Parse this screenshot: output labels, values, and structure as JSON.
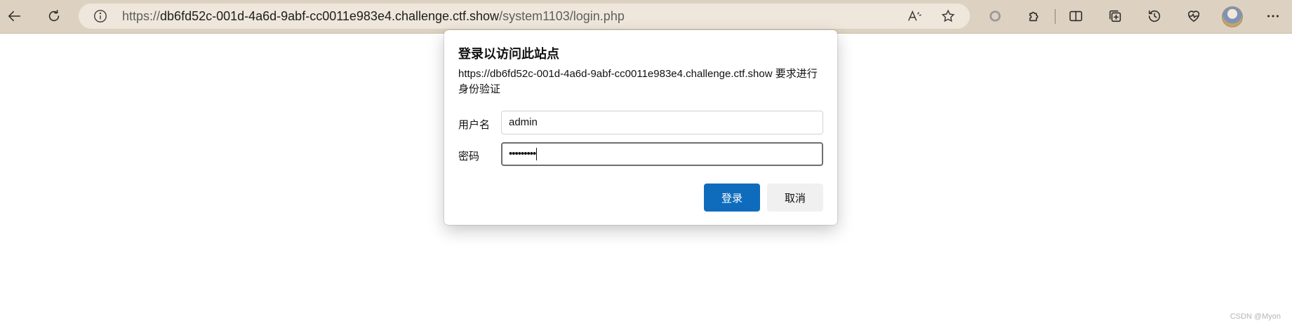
{
  "browser": {
    "url_scheme": "https://",
    "url_host": "db6fd52c-001d-4a6d-9abf-cc0011e983e4.challenge.ctf.show",
    "url_path": "/system1103/login.php",
    "icons": {
      "back": "back-arrow-icon",
      "reload": "reload-icon",
      "site_info": "info-icon",
      "read_aloud": "read-aloud-icon",
      "favorite": "star-icon",
      "extension_circle": "extension-circle-icon",
      "extensions": "puzzle-icon",
      "split_screen": "split-screen-icon",
      "collections": "collections-icon",
      "history": "history-icon",
      "performance": "heartbeat-icon",
      "profile": "avatar",
      "menu": "more-icon"
    }
  },
  "dialog": {
    "title": "登录以访问此站点",
    "message": "https://db6fd52c-001d-4a6d-9abf-cc0011e983e4.challenge.ctf.show 要求进行身份验证",
    "username_label": "用户名",
    "username_value": "admin",
    "password_label": "密码",
    "password_mask": "•••••••••",
    "login_button": "登录",
    "cancel_button": "取消"
  },
  "watermark": "CSDN @Myon⁠⁠",
  "colors": {
    "chrome_bg": "#ddd2c1",
    "address_bg": "#efe7dc",
    "primary_button": "#0f6cbd"
  }
}
